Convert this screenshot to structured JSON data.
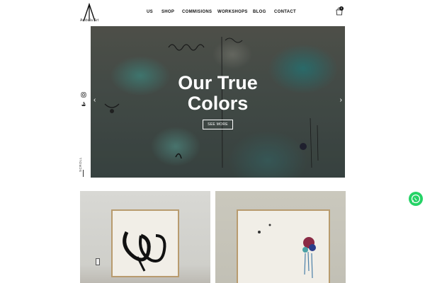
{
  "brand": {
    "logo_letter": "A",
    "name": "Ambala Art"
  },
  "nav": {
    "items": [
      {
        "label": "US"
      },
      {
        "label": "SHOP"
      },
      {
        "label": "COMMISIONS"
      },
      {
        "label": "WORKSHOPS"
      },
      {
        "label": "BLOG"
      },
      {
        "label": "CONTACT"
      }
    ]
  },
  "cart": {
    "count": "0",
    "icon": "shopping-bag-icon"
  },
  "hero": {
    "title_line1": "Our True",
    "title_line2": "Colors",
    "cta_label": "SEE MORE",
    "prev_arrow": "‹",
    "next_arrow": "›"
  },
  "side": {
    "instagram_icon": "instagram-icon",
    "other_icon": "boat-icon",
    "scroll_label": "SCROLL"
  },
  "gallery": {
    "items": [
      {
        "icon": "framed-painting"
      },
      {
        "icon": "framed-painting"
      }
    ]
  },
  "whatsapp": {
    "icon": "whatsapp-icon",
    "color": "#25d366"
  }
}
